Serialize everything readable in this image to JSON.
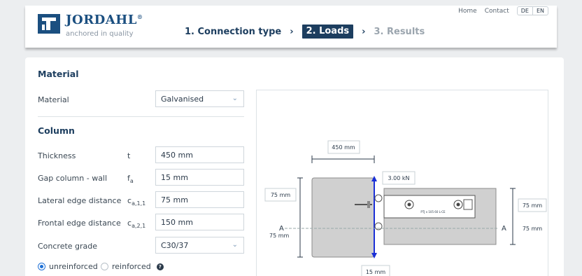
{
  "header": {
    "brand": "JORDAHL",
    "brand_mark": "®",
    "tagline": "anchored in quality",
    "steps": [
      {
        "label": "1. Connection type"
      },
      {
        "label": "2. Loads"
      },
      {
        "label": "3. Results"
      }
    ],
    "step_separator": "›",
    "nav": {
      "home": "Home",
      "contact": "Contact",
      "lang_de": "DE",
      "lang_en": "EN"
    }
  },
  "material_section": {
    "title": "Material",
    "label": "Material",
    "value": "Galvanised"
  },
  "column_section": {
    "title": "Column",
    "rows": [
      {
        "label": "Thickness",
        "symbol": "t",
        "sub": "",
        "value": "450 mm"
      },
      {
        "label": "Gap column - wall",
        "symbol": "f",
        "sub": "a",
        "value": "15 mm"
      },
      {
        "label": "Lateral edge distance",
        "symbol": "c",
        "sub": "a,1,1",
        "value": "75 mm"
      },
      {
        "label": "Frontal edge distance",
        "symbol": "c",
        "sub": "a,2,1",
        "value": "150 mm"
      }
    ],
    "concrete_label": "Concrete grade",
    "concrete_value": "C30/37",
    "radio_unreinforced": "unreinforced",
    "radio_reinforced": "reinforced",
    "help": "?"
  },
  "diagram": {
    "top_dim": "450 mm",
    "load": "3.00 kN",
    "left_dim": "75 mm",
    "right_dim_top": "75 mm",
    "right_dim_bottom": "75 mm",
    "section_a": "A",
    "left_dim_bottom": "75 mm",
    "bottom_dim": "15 mm",
    "plate_text": "PTJ x 105 60 L-CE"
  },
  "colors": {
    "brand": "#1b4f80",
    "accent": "#1d3e5f",
    "force": "#1a2fd6"
  }
}
